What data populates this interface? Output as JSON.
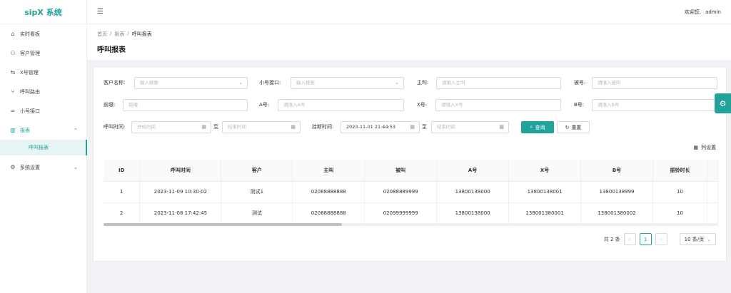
{
  "app": {
    "logo": "sipX 系统"
  },
  "sidebar": {
    "items": [
      {
        "label": "实时看板",
        "icon": "home-icon",
        "glyph": "⌂"
      },
      {
        "label": "客户管理",
        "icon": "users-icon",
        "glyph": "⚇"
      },
      {
        "label": "X号管理",
        "icon": "swap-icon",
        "glyph": "⇆"
      },
      {
        "label": "呼叫路由",
        "icon": "branch-icon",
        "glyph": "⑂"
      },
      {
        "label": "小号接口",
        "icon": "link-icon",
        "glyph": "∞"
      },
      {
        "label": "报表",
        "icon": "chart-icon",
        "glyph": "▥"
      },
      {
        "label": "系统设置",
        "icon": "gear-icon",
        "glyph": "⚙"
      }
    ],
    "sub_active": "呼叫报表"
  },
  "header": {
    "welcome": "欢迎您,",
    "user": "admin"
  },
  "breadcrumb": [
    "首页",
    "报表",
    "呼叫报表"
  ],
  "page_title": "呼叫报表",
  "filters": {
    "customer_label": "客户名称:",
    "customer_ph": "输入搜索",
    "port_label": "小号接口:",
    "port_ph": "输入搜索",
    "caller_label": "主叫:",
    "caller_ph": "请填入主叫",
    "callee_label": "被号:",
    "callee_ph": "请填入被叫",
    "prefix_label": "前缀:",
    "prefix_ph": "前缀",
    "a_label": "A号:",
    "a_ph": "请填入A号",
    "x_label": "X号:",
    "x_ph": "请填入X号",
    "b_label": "B号:",
    "b_ph": "请填入B号",
    "calltime_label": "呼叫时间:",
    "start_ph": "开始时间",
    "to": "至",
    "end_ph": "结束时间",
    "hangup_label": "挂断时间:",
    "hangup_start": "2023-11-01 21:44:53",
    "hangup_end_ph": "结束时间",
    "query": "查询",
    "reset": "重置"
  },
  "column_settings": "列设置",
  "table": {
    "headers": [
      "ID",
      "呼叫时间",
      "客户",
      "主叫",
      "被叫",
      "A号",
      "X号",
      "B号",
      "振铃时长"
    ],
    "rows": [
      [
        "1",
        "2023-11-09 10:30:02",
        "测试1",
        "02088888888",
        "02088889999",
        "13800138000",
        "13800138001",
        "13800138999",
        "10"
      ],
      [
        "2",
        "2023-11-08 17:42:45",
        "测试",
        "02088888888",
        "02099999999",
        "13800138000",
        "138001380001",
        "138001380002",
        "10"
      ]
    ]
  },
  "pager": {
    "total": "共 2 条",
    "current": "1",
    "size": "10 条/页"
  }
}
